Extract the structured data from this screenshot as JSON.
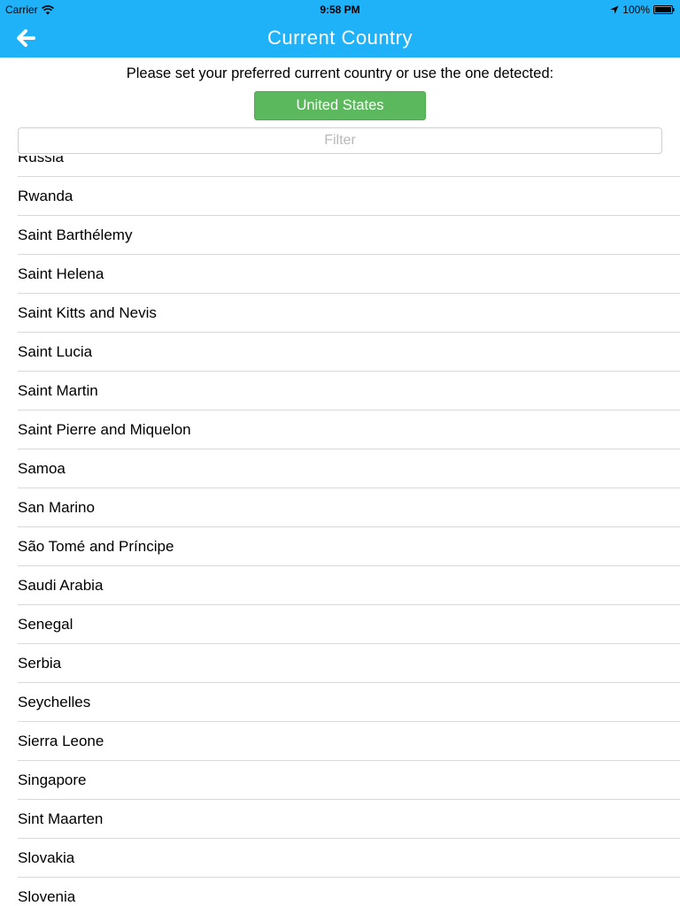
{
  "status_bar": {
    "carrier": "Carrier",
    "time": "9:58 PM",
    "battery": "100%"
  },
  "nav": {
    "title": "Current Country",
    "back_icon": "arrow-left-icon"
  },
  "instruction": "Please set your preferred current country or use the one detected:",
  "detected_country": "United States",
  "filter": {
    "placeholder": "Filter",
    "value": ""
  },
  "countries": [
    "Russia",
    "Rwanda",
    "Saint Barthélemy",
    "Saint Helena",
    "Saint Kitts and Nevis",
    "Saint Lucia",
    "Saint Martin",
    "Saint Pierre and Miquelon",
    "Samoa",
    "San Marino",
    "São Tomé and Príncipe",
    "Saudi Arabia",
    "Senegal",
    "Serbia",
    "Seychelles",
    "Sierra Leone",
    "Singapore",
    "Sint Maarten",
    "Slovakia",
    "Slovenia"
  ],
  "colors": {
    "nav_background": "#1fb2f8",
    "detected_button": "#5cb85c",
    "divider": "#d9d9d9"
  }
}
